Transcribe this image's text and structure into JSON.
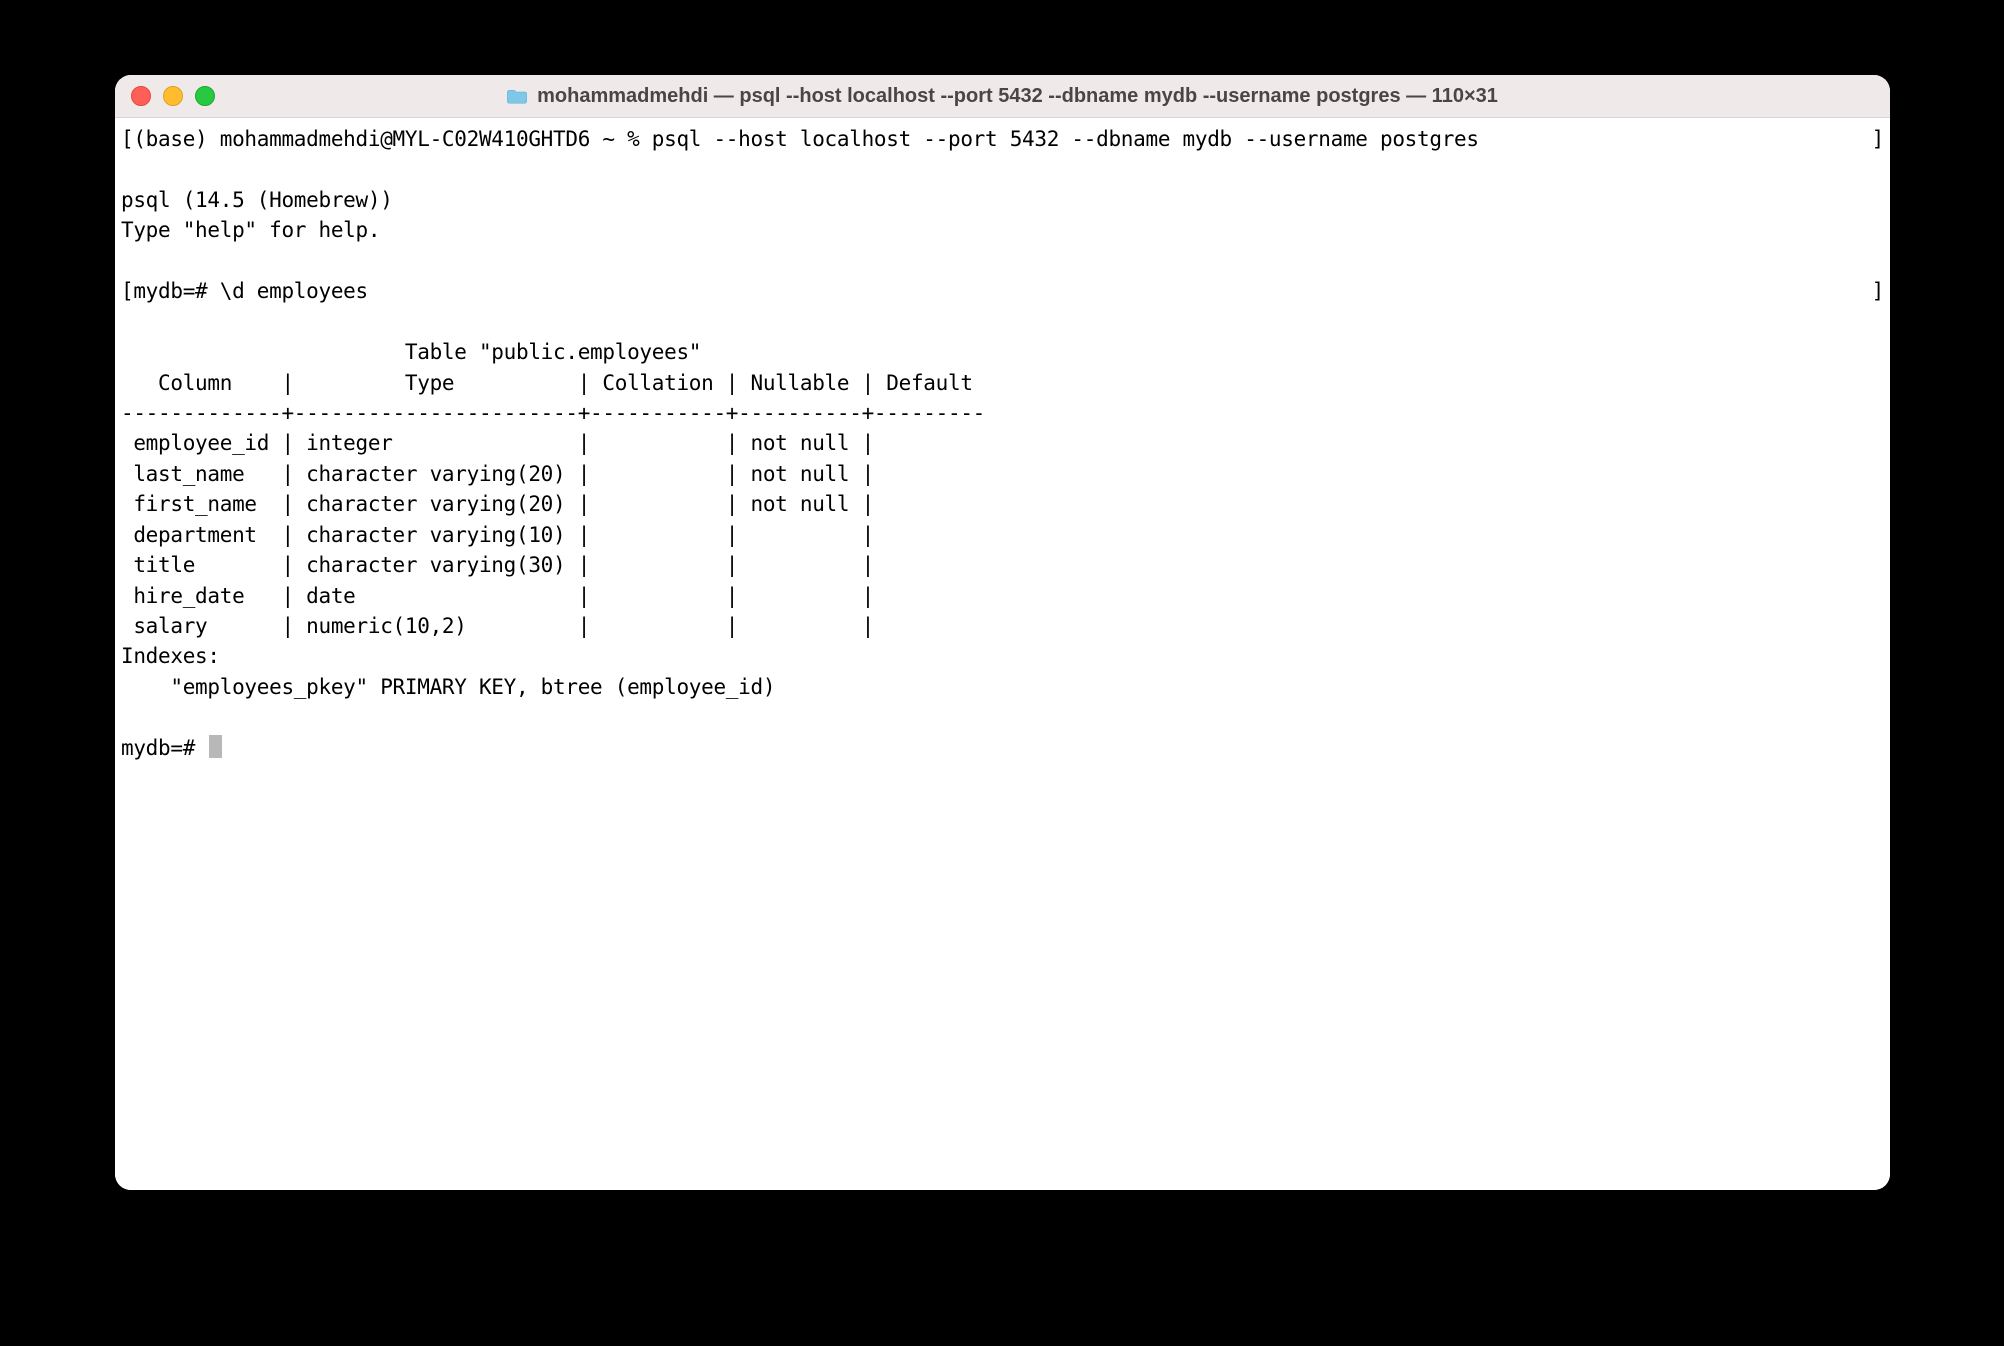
{
  "window": {
    "title": "mohammadmehdi — psql --host localhost --port 5432 --dbname mydb --username postgres — 110×31"
  },
  "terminal": {
    "prompt_line": "(base) mohammadmehdi@MYL-C02W410GHTD6 ~ % psql --host localhost --port 5432 --dbname mydb --username postgres",
    "psql_version": "psql (14.5 (Homebrew))",
    "help_line": "Type \"help\" for help.",
    "command_line": "mydb=# \\d employees",
    "table_title": "                       Table \"public.employees\"",
    "header": "   Column    |         Type          | Collation | Nullable | Default ",
    "divider": "-------------+-----------------------+-----------+----------+---------",
    "rows": {
      "r0": " employee_id | integer               |           | not null | ",
      "r1": " last_name   | character varying(20) |           | not null | ",
      "r2": " first_name  | character varying(20) |           | not null | ",
      "r3": " department  | character varying(10) |           |          | ",
      "r4": " title       | character varying(30) |           |          | ",
      "r5": " hire_date   | date                  |           |          | ",
      "r6": " salary      | numeric(10,2)         |           |          | "
    },
    "indexes_label": "Indexes:",
    "indexes_line": "    \"employees_pkey\" PRIMARY KEY, btree (employee_id)",
    "prompt2": "mydb=# "
  }
}
